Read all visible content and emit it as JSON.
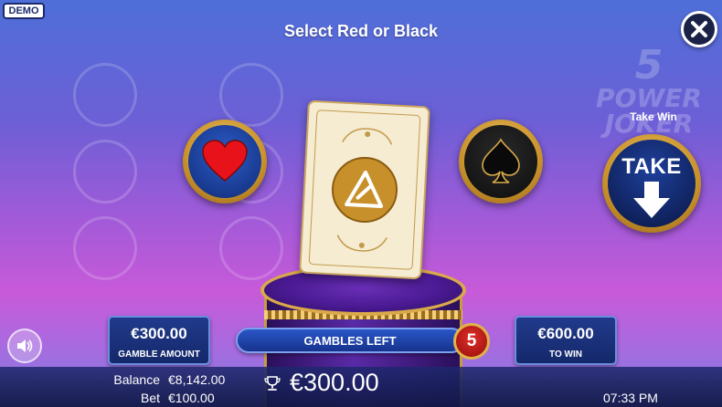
{
  "badge": "DEMO",
  "title": "Select Red or Black",
  "background_logo": {
    "line1": "5",
    "line2": "POWER",
    "line3": "JOKER"
  },
  "icons": {
    "close": "close-icon",
    "red_suit": "heart-icon",
    "black_suit": "spade-icon",
    "take": "arrow-down-icon",
    "sound": "speaker-icon",
    "win": "trophy-icon"
  },
  "take_win": {
    "label": "Take Win",
    "button_text": "TAKE"
  },
  "gamble_amount": {
    "value": "€300.00",
    "label": "GAMBLE AMOUNT"
  },
  "to_win": {
    "value": "€600.00",
    "label": "TO WIN"
  },
  "gambles_left": {
    "label": "GAMBLES LEFT",
    "count": "5"
  },
  "footer": {
    "balance_label": "Balance",
    "balance_value": "€8,142.00",
    "bet_label": "Bet",
    "bet_value": "€100.00",
    "win_value": "€300.00",
    "time": "07:33 PM"
  },
  "colors": {
    "red_suit": "#e8121b",
    "gold": "#d9a94a",
    "panel_blue": "#14286a"
  }
}
